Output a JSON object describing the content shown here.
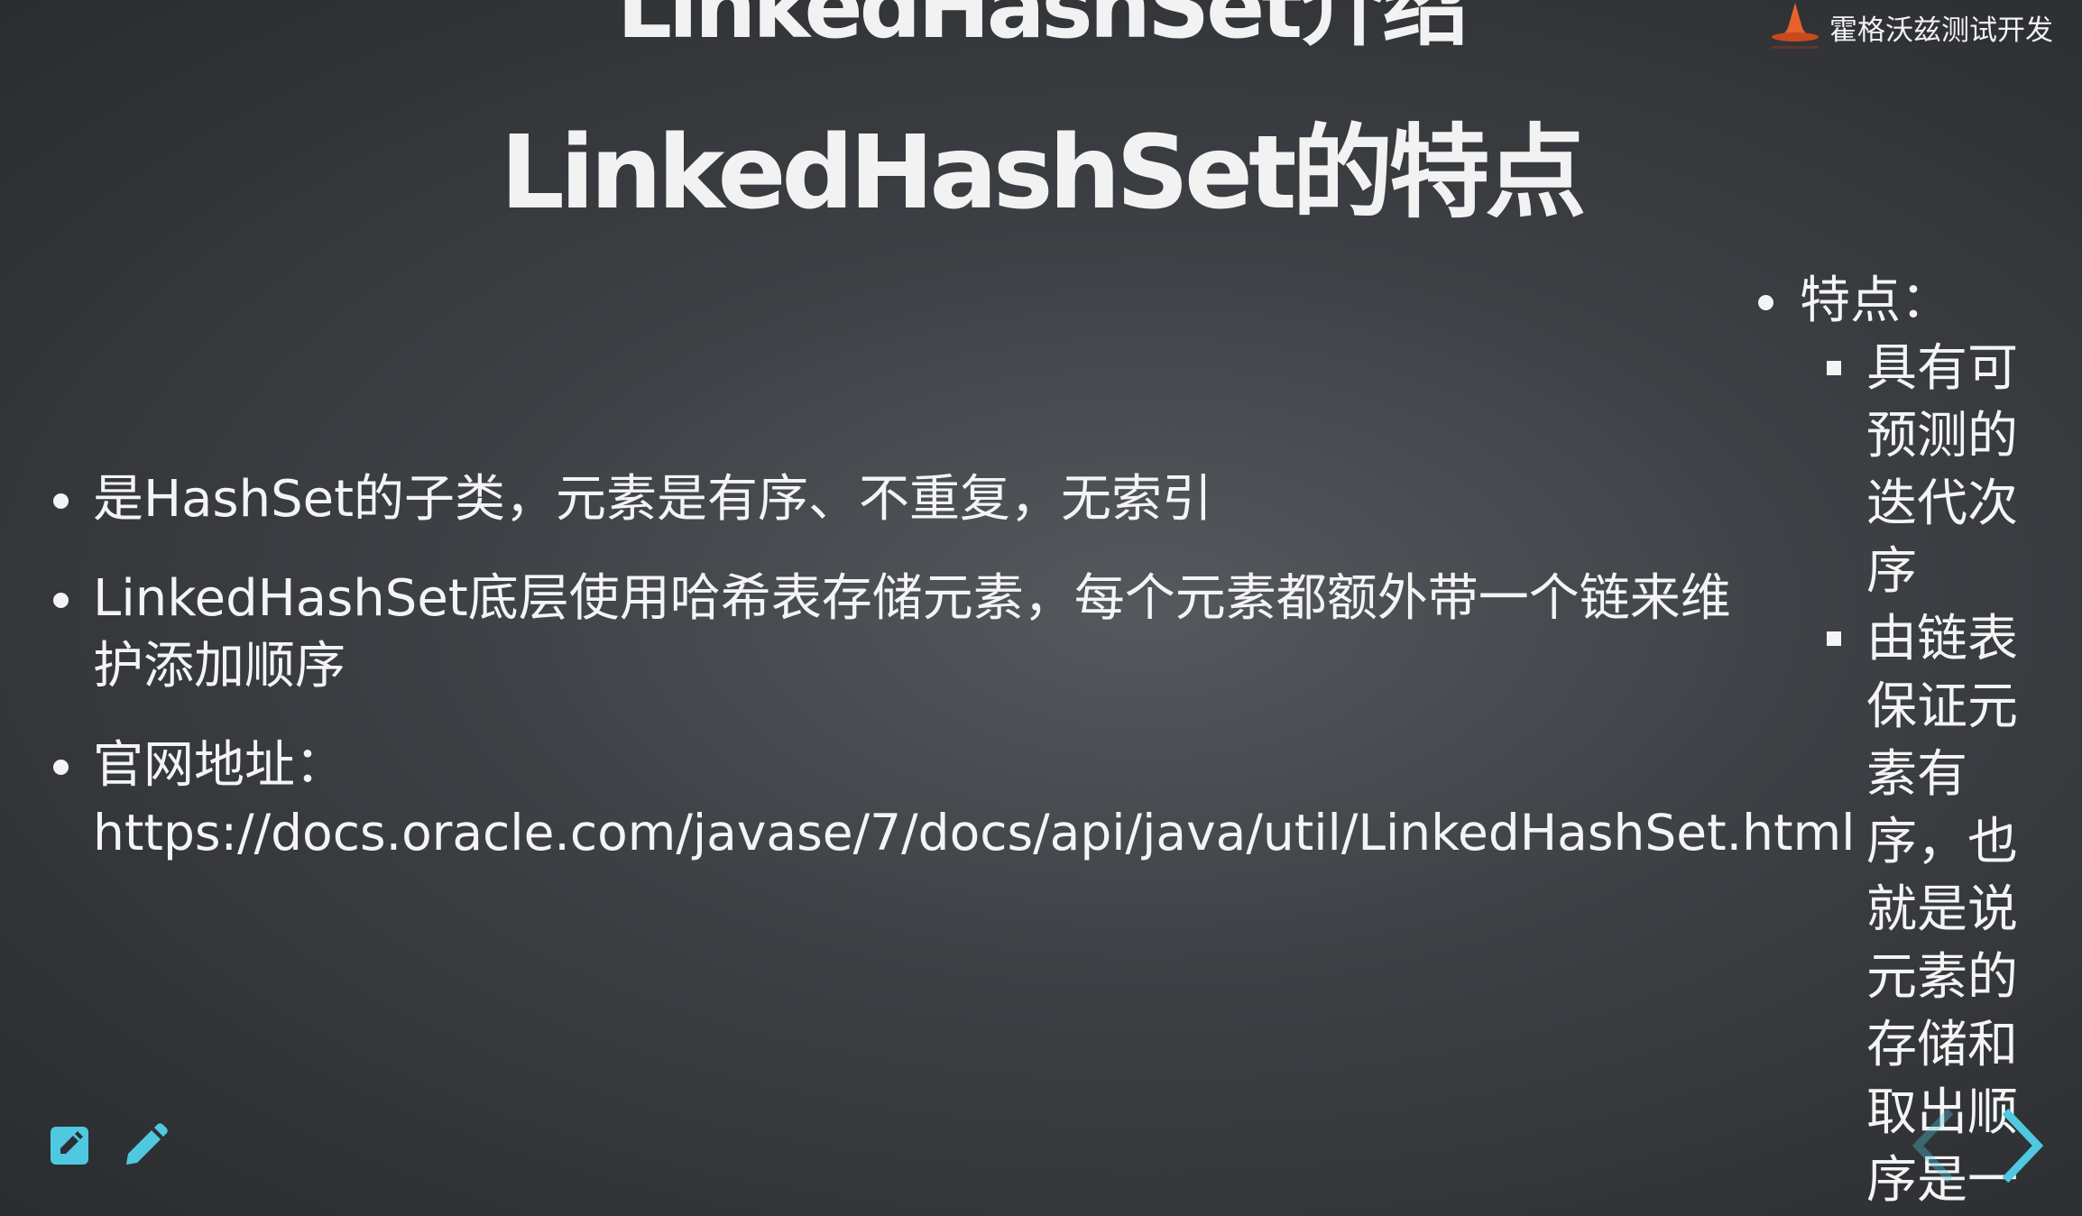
{
  "slide": {
    "title_top": "LinkedHashSet介绍",
    "title_main": "LinkedHashSet的特点"
  },
  "logo": {
    "text": "霍格沃兹测试开发"
  },
  "bullets": {
    "item1": "是HashSet的子类，元素是有序、不重复，无索引",
    "item2": "LinkedHashSet底层使用哈希表存储元素，每个元素都额外带一个链来维护添加顺序",
    "item3_label": "官网地址：",
    "item3_url": "https://docs.oracle.com/javase/7/docs/api/java/util/LinkedHashSet.html"
  },
  "side": {
    "heading": "特点：",
    "items": [
      "具有可预测的迭代次序",
      "由链表保证元素有序，也就是说元素的存储和取出顺序是一"
    ]
  },
  "colors": {
    "accent": "#4ec9e0",
    "text": "#f4f4f4",
    "logo_orange": "#e8602c"
  },
  "icons": {
    "board": "whiteboard-icon",
    "pencil": "pencil-icon",
    "prev": "chevron-left-icon",
    "next": "chevron-right-icon"
  }
}
